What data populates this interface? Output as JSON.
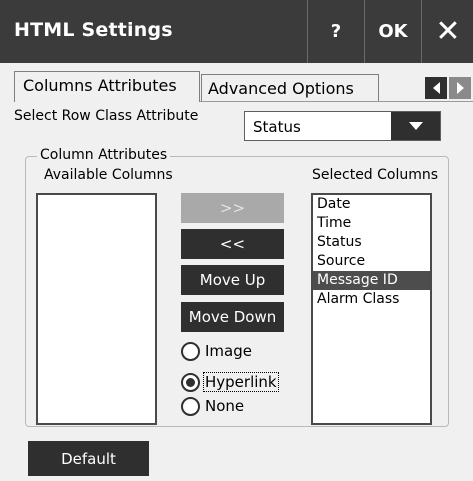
{
  "window": {
    "title": "HTML Settings",
    "help_label": "?",
    "ok_label": "OK",
    "close_label": "✕"
  },
  "tabs": [
    {
      "label": "Columns Attributes",
      "active": true
    },
    {
      "label": "Advanced Options",
      "active": false
    }
  ],
  "row_class": {
    "label": "Select Row Class Attribute",
    "value": "Status"
  },
  "column_attributes": {
    "legend": "Column Attributes",
    "available_label": "Available Columns",
    "selected_label": "Selected Columns",
    "available_items": [],
    "selected_items": [
      "Date",
      "Time",
      "Status",
      "Source",
      "Message ID",
      "Alarm Class"
    ],
    "selected_highlight": "Message ID"
  },
  "buttons": {
    "add_all": ">>",
    "remove_all": "<<",
    "move_up": "Move Up",
    "move_down": "Move Down",
    "default": "Default"
  },
  "radio_options": [
    {
      "label": "Image",
      "checked": false
    },
    {
      "label": "Hyperlink",
      "checked": true
    },
    {
      "label": "None",
      "checked": false
    }
  ],
  "colors": {
    "titlebar": "#3b3b3b",
    "button": "#2f2f2f",
    "disabled_button": "#a9a9a9",
    "selection": "#4d4d4d"
  }
}
